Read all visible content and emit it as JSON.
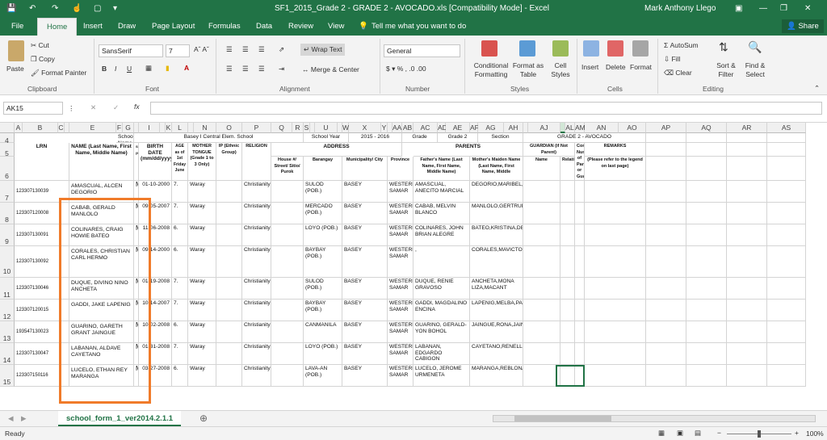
{
  "window": {
    "title": "SF1_2015_Grade 2 - GRADE 2 - AVOCADO.xls  [Compatibility Mode]  -  Excel",
    "user": "Mark Anthony Llego"
  },
  "tabs": [
    "File",
    "Home",
    "Insert",
    "Draw",
    "Page Layout",
    "Formulas",
    "Data",
    "Review",
    "View"
  ],
  "tell_me": "Tell me what you want to do",
  "share": "Share",
  "ribbon": {
    "clipboard": {
      "paste": "Paste",
      "cut": "Cut",
      "copy": "Copy",
      "format_painter": "Format Painter",
      "label": "Clipboard"
    },
    "font": {
      "name": "SansSerif",
      "size": "7",
      "label": "Font"
    },
    "alignment": {
      "wrap": "Wrap Text",
      "merge": "Merge & Center",
      "label": "Alignment"
    },
    "number": {
      "format": "General",
      "label": "Number"
    },
    "styles": {
      "cond": "Conditional Formatting",
      "table": "Format as Table",
      "cell": "Cell Styles",
      "label": "Styles"
    },
    "cells": {
      "insert": "Insert",
      "delete": "Delete",
      "format": "Format",
      "label": "Cells"
    },
    "editing": {
      "autosum": "AutoSum",
      "fill": "Fill",
      "clear": "Clear",
      "sort": "Sort & Filter",
      "find": "Find & Select",
      "label": "Editing"
    }
  },
  "namebox": "AK15",
  "columns": [
    "A",
    "B",
    "C",
    "D",
    "E",
    "F",
    "G",
    "H",
    "I",
    "J",
    "K",
    "L",
    "M",
    "N",
    "O",
    "P",
    "Q",
    "R",
    "S",
    "T",
    "U",
    "V",
    "W",
    "X",
    "Y",
    "Z",
    "AA",
    "AB",
    "AC",
    "AD",
    "AE",
    "AF",
    "AG",
    "AH",
    "AI",
    "AJ",
    "AK",
    "AL",
    "AM",
    "AN",
    "AO",
    "AP",
    "AQ",
    "AR",
    "AS"
  ],
  "rows": [
    "4",
    "5",
    "6",
    "7",
    "8",
    "9",
    "10",
    "11",
    "12",
    "13",
    "14",
    "15"
  ],
  "header": {
    "school_name_label": "School Name",
    "school_name": "Basey I Central Elem. School",
    "school_year_label": "School Year",
    "school_year": "2015 - 2016",
    "grade_label": "Grade",
    "grade": "Grade 2",
    "section_label": "Section",
    "section": "GRADE 2 - AVOCADO",
    "lrn": "LRN",
    "name": "NAME\n(Last Name, First Name, Middle Name)",
    "sex": "SEX (M/F)",
    "birth": "BIRTH DATE (mm/dd/yyyy)",
    "age": "AGE as of 1st Friday June",
    "mother_tongue": "MOTHER TONGUE (Grade 1 to 3 Only)",
    "ip": "IP (Ethnic Group)",
    "religion": "RELIGION",
    "address": "ADDRESS",
    "house": "House #/ Street/ Sitio/ Purok",
    "barangay": "Barangay",
    "municipality": "Municipality/ City",
    "province": "Province",
    "parents": "PARENTS",
    "father": "Father's Name (Last Name, First Name, Middle Name)",
    "mother": "Mother's Maiden Name (Last Name, First Name, Middle",
    "guardian": "GUARDIAN (if Not Parent)",
    "g_name": "Name",
    "relationship": "Relationship",
    "contact": "Contact Number of Parent or Guardian",
    "remarks": "REMARKS",
    "remarks_note": "(Please refer to the legend on last page)"
  },
  "students": [
    {
      "lrn": "123307130039",
      "name": "AMASCUAL, ALCEN DEGORIO",
      "sex": "M",
      "birth": "01-10-2000",
      "age": "7.",
      "mt": "Waray",
      "rel": "Christianity",
      "brgy": "SULOD (POB.)",
      "mun": "BASEY",
      "prov": "WESTERN SAMAR",
      "father": "AMASCUAL, ANECITO MARCIAL",
      "mother": "DEGORIO,MARIBEL,MACABUTAS,"
    },
    {
      "lrn": "123307120008",
      "name": "CABAB, GERALD MANLOLO",
      "sex": "M",
      "birth": "09-05-2007",
      "age": "7.",
      "mt": "Waray",
      "rel": "Christianity",
      "brgy": "MERCADO (POB.)",
      "mun": "BASEY",
      "prov": "WESTERN SAMAR",
      "father": "CABAB, MELVIN BLANCO",
      "mother": "MANLOLO,GERTRUDES,DIODOCO,"
    },
    {
      "lrn": "123307130091",
      "name": "COLINARES, CRAIG HOWIE BATEO",
      "sex": "M",
      "birth": "11-06-2008",
      "age": "6.",
      "mt": "Waray",
      "rel": "Christianity",
      "brgy": "LOYO (POB.)",
      "mun": "BASEY",
      "prov": "WESTERN SAMAR",
      "father": "COLINARES, JOHN BRIAN ALEGRE",
      "mother": "BATEO,KRISTINA,DELMONTE,"
    },
    {
      "lrn": "123307130092",
      "name": "CORALES, CHRISTIAN CARL HERMO",
      "sex": "M",
      "birth": "09-14-2000",
      "age": "6.",
      "mt": "Waray",
      "rel": "Christianity",
      "brgy": "BAYBAY (POB.)",
      "mun": "BASEY",
      "prov": "WESTERN SAMAR",
      "father": ",",
      "mother": "CORALES,MAVICTORIA,HERMO,"
    },
    {
      "lrn": "123307130046",
      "name": "DUQUE, DIVINO NINO ANCHETA",
      "sex": "M",
      "birth": "01-19-2008",
      "age": "7.",
      "mt": "Waray",
      "rel": "Christianity",
      "brgy": "SULOD (POB.)",
      "mun": "BASEY",
      "prov": "WESTERN SAMAR",
      "father": "DUQUE, RENIE GRAVOSO",
      "mother": "ANCHETA,MONA LIZA,MACANT"
    },
    {
      "lrn": "123307120015",
      "name": "GADDI, JAKE LAPENIG",
      "sex": "M",
      "birth": "10-14-2007",
      "age": "7.",
      "mt": "Waray",
      "rel": "Christianity",
      "brgy": "BAYBAY (POB.)",
      "mun": "BASEY",
      "prov": "WESTERN SAMAR",
      "father": "GADDI, MAGDALINO ENCINA",
      "mother": "LAPENIG,MELBA,PADUA,"
    },
    {
      "lrn": "193547130023",
      "name": "GUARINO, GARETH GRANT JAINGUE",
      "sex": "M",
      "birth": "10-02-2008",
      "age": "6.",
      "mt": "Waray",
      "rel": "Christianity",
      "brgy": "CANMANILA",
      "mun": "BASEY",
      "prov": "WESTERN SAMAR",
      "father": "GUARINO, GERALD-YON BOHOL",
      "mother": "JAINGUE,RONA,JAINGUE,"
    },
    {
      "lrn": "123307130047",
      "name": "LABANAN, ALDAVE CAYETANO",
      "sex": "M",
      "birth": "01-31-2008",
      "age": "7.",
      "mt": "Waray",
      "rel": "Christianity",
      "brgy": "LOYO (POB.)",
      "mun": "BASEY",
      "prov": "WESTERN SAMAR",
      "father": "LABANAN, EDGARDO CABIGON",
      "mother": "CAYETANO,RENELLE,GACUSANA,"
    },
    {
      "lrn": "123307150116",
      "name": "LUCELO, ETHAN REY MARANGA",
      "sex": "M",
      "birth": "03-27-2008",
      "age": "6.",
      "mt": "Waray",
      "rel": "Christianity",
      "brgy": "LAVA-AN (POB.)",
      "mun": "BASEY",
      "prov": "WESTERN SAMAR",
      "father": "LUCELO, JEROME URMENETA",
      "mother": "MARANGA,REBLONA,BALEROS"
    }
  ],
  "sheet_tab": "school_form_1_ver2014.2.1.1",
  "status": {
    "ready": "Ready",
    "zoom": "100%"
  }
}
